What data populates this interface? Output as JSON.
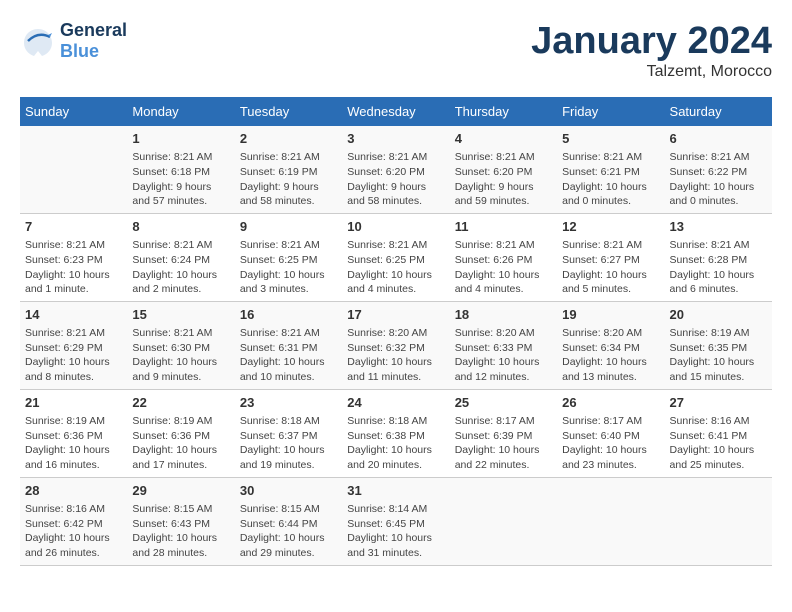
{
  "header": {
    "logo_general": "General",
    "logo_blue": "Blue",
    "month": "January 2024",
    "location": "Talzemt, Morocco"
  },
  "days_of_week": [
    "Sunday",
    "Monday",
    "Tuesday",
    "Wednesday",
    "Thursday",
    "Friday",
    "Saturday"
  ],
  "weeks": [
    [
      {
        "day": "",
        "info": ""
      },
      {
        "day": "1",
        "info": "Sunrise: 8:21 AM\nSunset: 6:18 PM\nDaylight: 9 hours\nand 57 minutes."
      },
      {
        "day": "2",
        "info": "Sunrise: 8:21 AM\nSunset: 6:19 PM\nDaylight: 9 hours\nand 58 minutes."
      },
      {
        "day": "3",
        "info": "Sunrise: 8:21 AM\nSunset: 6:20 PM\nDaylight: 9 hours\nand 58 minutes."
      },
      {
        "day": "4",
        "info": "Sunrise: 8:21 AM\nSunset: 6:20 PM\nDaylight: 9 hours\nand 59 minutes."
      },
      {
        "day": "5",
        "info": "Sunrise: 8:21 AM\nSunset: 6:21 PM\nDaylight: 10 hours\nand 0 minutes."
      },
      {
        "day": "6",
        "info": "Sunrise: 8:21 AM\nSunset: 6:22 PM\nDaylight: 10 hours\nand 0 minutes."
      }
    ],
    [
      {
        "day": "7",
        "info": "Sunrise: 8:21 AM\nSunset: 6:23 PM\nDaylight: 10 hours\nand 1 minute."
      },
      {
        "day": "8",
        "info": "Sunrise: 8:21 AM\nSunset: 6:24 PM\nDaylight: 10 hours\nand 2 minutes."
      },
      {
        "day": "9",
        "info": "Sunrise: 8:21 AM\nSunset: 6:25 PM\nDaylight: 10 hours\nand 3 minutes."
      },
      {
        "day": "10",
        "info": "Sunrise: 8:21 AM\nSunset: 6:25 PM\nDaylight: 10 hours\nand 4 minutes."
      },
      {
        "day": "11",
        "info": "Sunrise: 8:21 AM\nSunset: 6:26 PM\nDaylight: 10 hours\nand 4 minutes."
      },
      {
        "day": "12",
        "info": "Sunrise: 8:21 AM\nSunset: 6:27 PM\nDaylight: 10 hours\nand 5 minutes."
      },
      {
        "day": "13",
        "info": "Sunrise: 8:21 AM\nSunset: 6:28 PM\nDaylight: 10 hours\nand 6 minutes."
      }
    ],
    [
      {
        "day": "14",
        "info": "Sunrise: 8:21 AM\nSunset: 6:29 PM\nDaylight: 10 hours\nand 8 minutes."
      },
      {
        "day": "15",
        "info": "Sunrise: 8:21 AM\nSunset: 6:30 PM\nDaylight: 10 hours\nand 9 minutes."
      },
      {
        "day": "16",
        "info": "Sunrise: 8:21 AM\nSunset: 6:31 PM\nDaylight: 10 hours\nand 10 minutes."
      },
      {
        "day": "17",
        "info": "Sunrise: 8:20 AM\nSunset: 6:32 PM\nDaylight: 10 hours\nand 11 minutes."
      },
      {
        "day": "18",
        "info": "Sunrise: 8:20 AM\nSunset: 6:33 PM\nDaylight: 10 hours\nand 12 minutes."
      },
      {
        "day": "19",
        "info": "Sunrise: 8:20 AM\nSunset: 6:34 PM\nDaylight: 10 hours\nand 13 minutes."
      },
      {
        "day": "20",
        "info": "Sunrise: 8:19 AM\nSunset: 6:35 PM\nDaylight: 10 hours\nand 15 minutes."
      }
    ],
    [
      {
        "day": "21",
        "info": "Sunrise: 8:19 AM\nSunset: 6:36 PM\nDaylight: 10 hours\nand 16 minutes."
      },
      {
        "day": "22",
        "info": "Sunrise: 8:19 AM\nSunset: 6:36 PM\nDaylight: 10 hours\nand 17 minutes."
      },
      {
        "day": "23",
        "info": "Sunrise: 8:18 AM\nSunset: 6:37 PM\nDaylight: 10 hours\nand 19 minutes."
      },
      {
        "day": "24",
        "info": "Sunrise: 8:18 AM\nSunset: 6:38 PM\nDaylight: 10 hours\nand 20 minutes."
      },
      {
        "day": "25",
        "info": "Sunrise: 8:17 AM\nSunset: 6:39 PM\nDaylight: 10 hours\nand 22 minutes."
      },
      {
        "day": "26",
        "info": "Sunrise: 8:17 AM\nSunset: 6:40 PM\nDaylight: 10 hours\nand 23 minutes."
      },
      {
        "day": "27",
        "info": "Sunrise: 8:16 AM\nSunset: 6:41 PM\nDaylight: 10 hours\nand 25 minutes."
      }
    ],
    [
      {
        "day": "28",
        "info": "Sunrise: 8:16 AM\nSunset: 6:42 PM\nDaylight: 10 hours\nand 26 minutes."
      },
      {
        "day": "29",
        "info": "Sunrise: 8:15 AM\nSunset: 6:43 PM\nDaylight: 10 hours\nand 28 minutes."
      },
      {
        "day": "30",
        "info": "Sunrise: 8:15 AM\nSunset: 6:44 PM\nDaylight: 10 hours\nand 29 minutes."
      },
      {
        "day": "31",
        "info": "Sunrise: 8:14 AM\nSunset: 6:45 PM\nDaylight: 10 hours\nand 31 minutes."
      },
      {
        "day": "",
        "info": ""
      },
      {
        "day": "",
        "info": ""
      },
      {
        "day": "",
        "info": ""
      }
    ]
  ]
}
